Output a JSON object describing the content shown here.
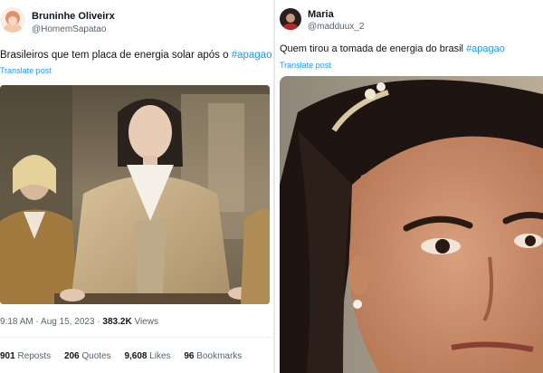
{
  "left_tweet": {
    "author_name": "Bruninhe Oliveirx",
    "author_handle": "@HomemSapatao",
    "text": "Brasileiros que tem placa de energia solar após o ",
    "hashtag": "#apagao",
    "translate_label": "Translate post",
    "time": "9:18 AM · Aug 15, 2023 · ",
    "views_count": "383.2K",
    "views_label": " Views",
    "reposts_count": "901",
    "reposts_label": " Reposts",
    "quotes_count": "206",
    "quotes_label": " Quotes",
    "likes_count": "9,608",
    "likes_label": " Likes",
    "bookmarks_count": "96",
    "bookmarks_label": " Bookmarks"
  },
  "right_tweet": {
    "author_name": "Maria",
    "author_handle": "@madduux_2",
    "text": "Quem tirou a tomada de energia do brasil ",
    "hashtag": "#apagao",
    "translate_label": "Translate post"
  },
  "colors": {
    "accent": "#1d9bf0",
    "secondary_text": "#536471"
  }
}
